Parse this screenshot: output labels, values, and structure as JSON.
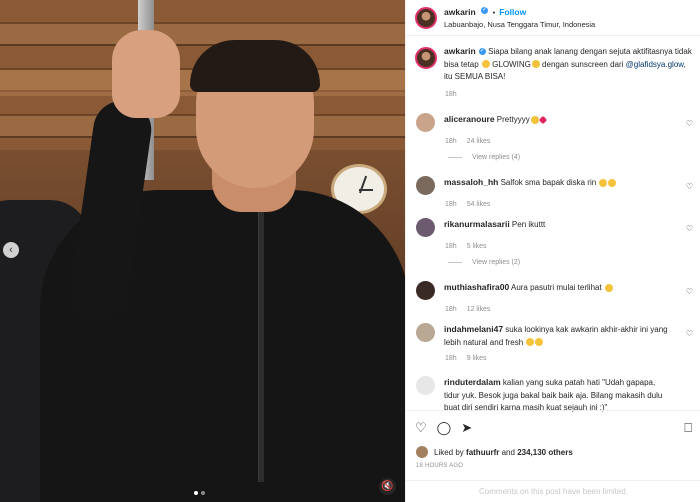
{
  "post": {
    "username": "awkarin",
    "follow_label": "Follow",
    "location": "Labuanbajo, Nusa Tenggara Timur, Indonesia",
    "caption_part1": "Siapa bilang anak lanang dengan sejuta aktifitasnya tidak bisa tetap ",
    "caption_glowing": "GLOWING",
    "caption_part2": " dengan sunscreen dari ",
    "caption_mention": "@glafidsya.glow",
    "caption_part3": ", itu SEMUA BISA!",
    "caption_time": "18h"
  },
  "comments": [
    {
      "user": "aliceranoure",
      "text": "Prettyyyy",
      "time": "18h",
      "likes": "24 likes",
      "replies": "View replies (4)"
    },
    {
      "user": "massaloh_hh",
      "text": "Salfok sma bapak diska rin ",
      "time": "18h",
      "likes": "54 likes"
    },
    {
      "user": "rikanurmalasarii",
      "text": "Pen ikuttt",
      "time": "18h",
      "likes": "5 likes",
      "replies": "View replies (2)"
    },
    {
      "user": "muthiashafira00",
      "text": "Aura pasutri mulai terlihat ",
      "time": "18h",
      "likes": "12 likes"
    },
    {
      "user": "indahmelani47",
      "text": "suka lookinya kak awkarin akhir-akhir ini yang lebih natural and fresh ",
      "time": "18h",
      "likes": "9 likes"
    },
    {
      "user": "rinduterdalam",
      "text": "kalian yang suka patah hati \"Udah gapapa, tidur yuk. Besok juga bakal baik baik aja. Bilang makasih dulu buat diri sendiri karna masih kuat sejauh ini :)\""
    }
  ],
  "footer": {
    "liked_by_prefix": "Liked by ",
    "liked_by_user": "fathuurfr",
    "liked_by_and": " and ",
    "liked_by_count": "234,130 others",
    "time_ago": "18 HOURS AGO",
    "comments_limited": "Comments on this post have been limited."
  },
  "colors": {
    "accent": "#0095f6",
    "verified": "#3897f0",
    "muted": "#8e8e8e"
  },
  "icons": [
    "heart-icon",
    "comment-icon",
    "share-icon",
    "bookmark-icon",
    "mute-icon",
    "chevron-left-icon",
    "verified-icon"
  ]
}
